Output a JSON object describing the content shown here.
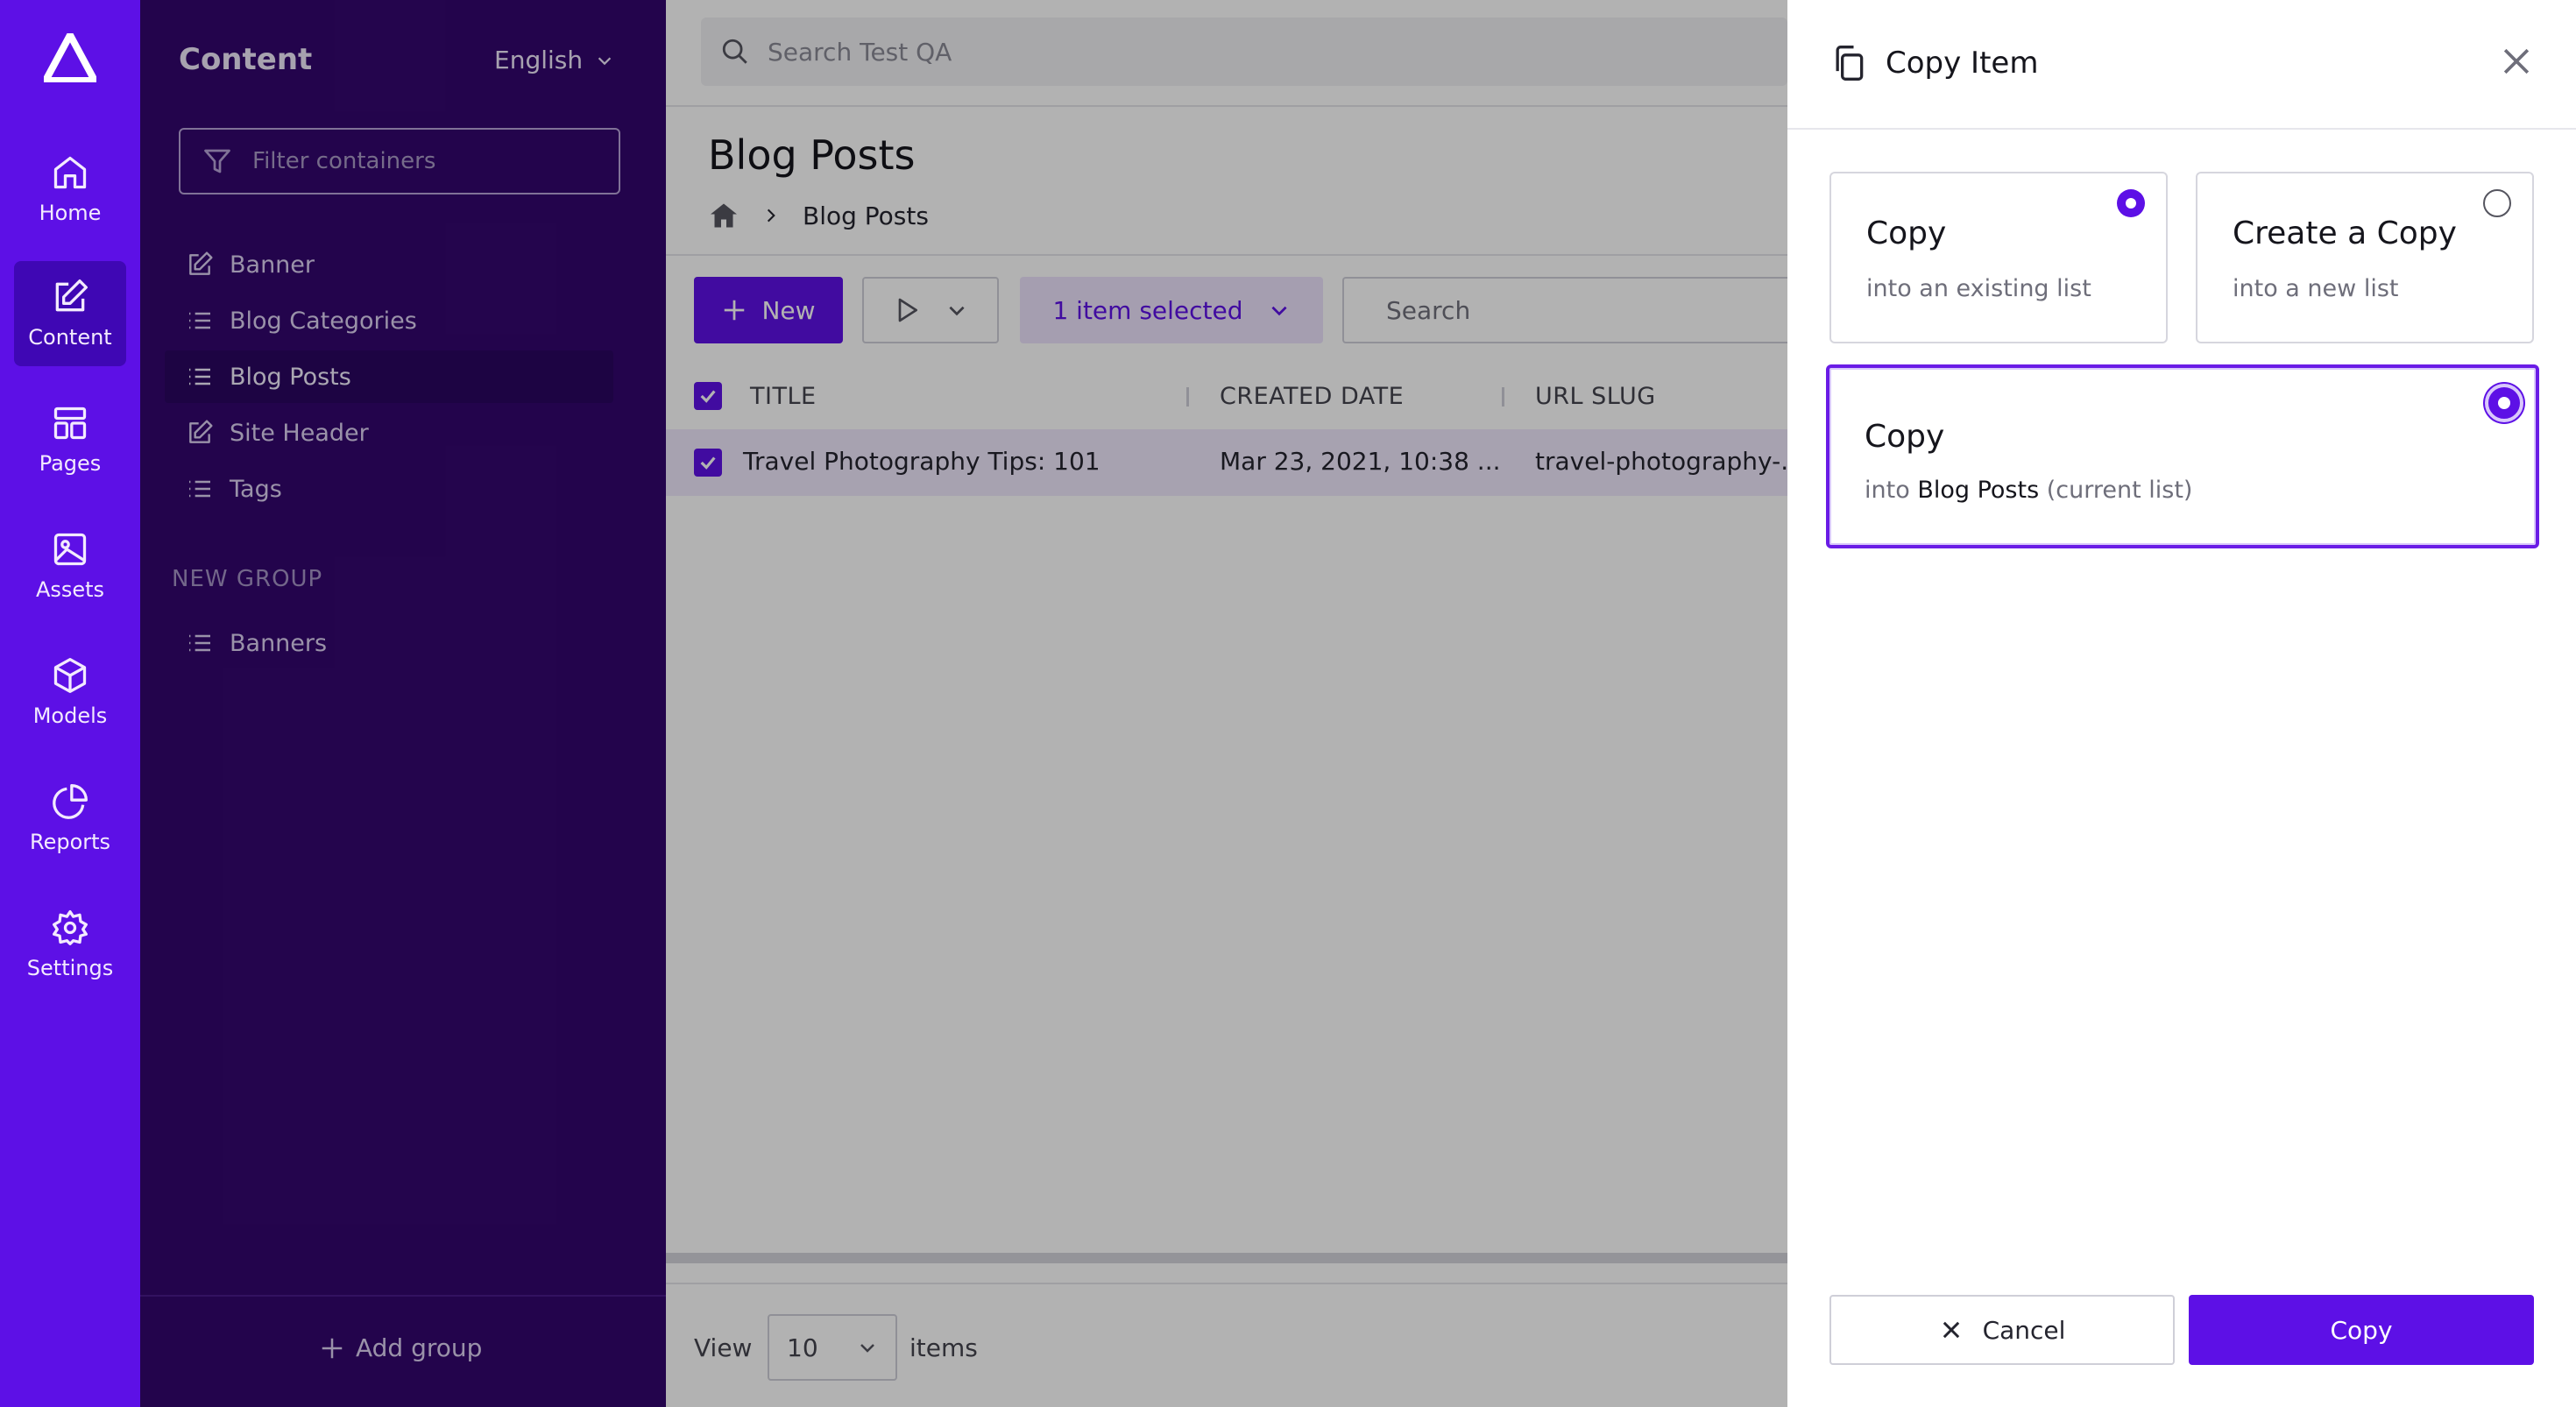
{
  "rail": {
    "logo": "agility-logo",
    "items": [
      {
        "label": "Home",
        "icon": "home-icon"
      },
      {
        "label": "Content",
        "icon": "edit-icon",
        "active": true
      },
      {
        "label": "Pages",
        "icon": "pages-layout-icon"
      },
      {
        "label": "Assets",
        "icon": "image-icon"
      },
      {
        "label": "Models",
        "icon": "cube-icon"
      },
      {
        "label": "Reports",
        "icon": "pie-chart-icon"
      },
      {
        "label": "Settings",
        "icon": "gear-icon"
      }
    ]
  },
  "panel": {
    "title": "Content",
    "language": "English",
    "filter_placeholder": "Filter containers",
    "items": [
      {
        "label": "Banner",
        "icon": "edit-icon"
      },
      {
        "label": "Blog Categories",
        "icon": "list-icon"
      },
      {
        "label": "Blog Posts",
        "icon": "list-icon",
        "active": true
      },
      {
        "label": "Site Header",
        "icon": "edit-icon"
      },
      {
        "label": "Tags",
        "icon": "list-icon"
      }
    ],
    "group_label": "NEW GROUP",
    "group_items": [
      {
        "label": "Banners",
        "icon": "list-icon"
      }
    ],
    "add_group": "Add group"
  },
  "main": {
    "search_placeholder": "Search Test QA",
    "page_title": "Blog Posts",
    "breadcrumb": [
      "Blog Posts"
    ],
    "new_label": "New",
    "selected_label": "1 item selected",
    "list_search_placeholder": "Search",
    "columns": [
      "TITLE",
      "CREATED DATE",
      "URL SLUG"
    ],
    "rows": [
      {
        "title": "Travel Photography Tips: 101",
        "created": "Mar 23, 2021, 10:38 ...",
        "slug": "travel-photography-...",
        "checked": true
      }
    ],
    "footer": {
      "view_label": "View",
      "page_size": "10",
      "items_label": "items"
    }
  },
  "drawer": {
    "title": "Copy Item",
    "options": [
      {
        "title": "Copy",
        "subtitle": "into an existing list",
        "selected": true
      },
      {
        "title": "Create a Copy",
        "subtitle": "into a new list",
        "selected": false
      },
      {
        "title": "Copy",
        "subtitle_prefix": "into",
        "subtitle_target": "Blog Posts",
        "subtitle_suffix": "(current list)",
        "selected": true
      }
    ],
    "cancel_label": "Cancel",
    "copy_label": "Copy"
  },
  "colors": {
    "brand": "#5d10e6",
    "panel_bg": "#33076e",
    "selection_bg": "#ece3fd"
  }
}
